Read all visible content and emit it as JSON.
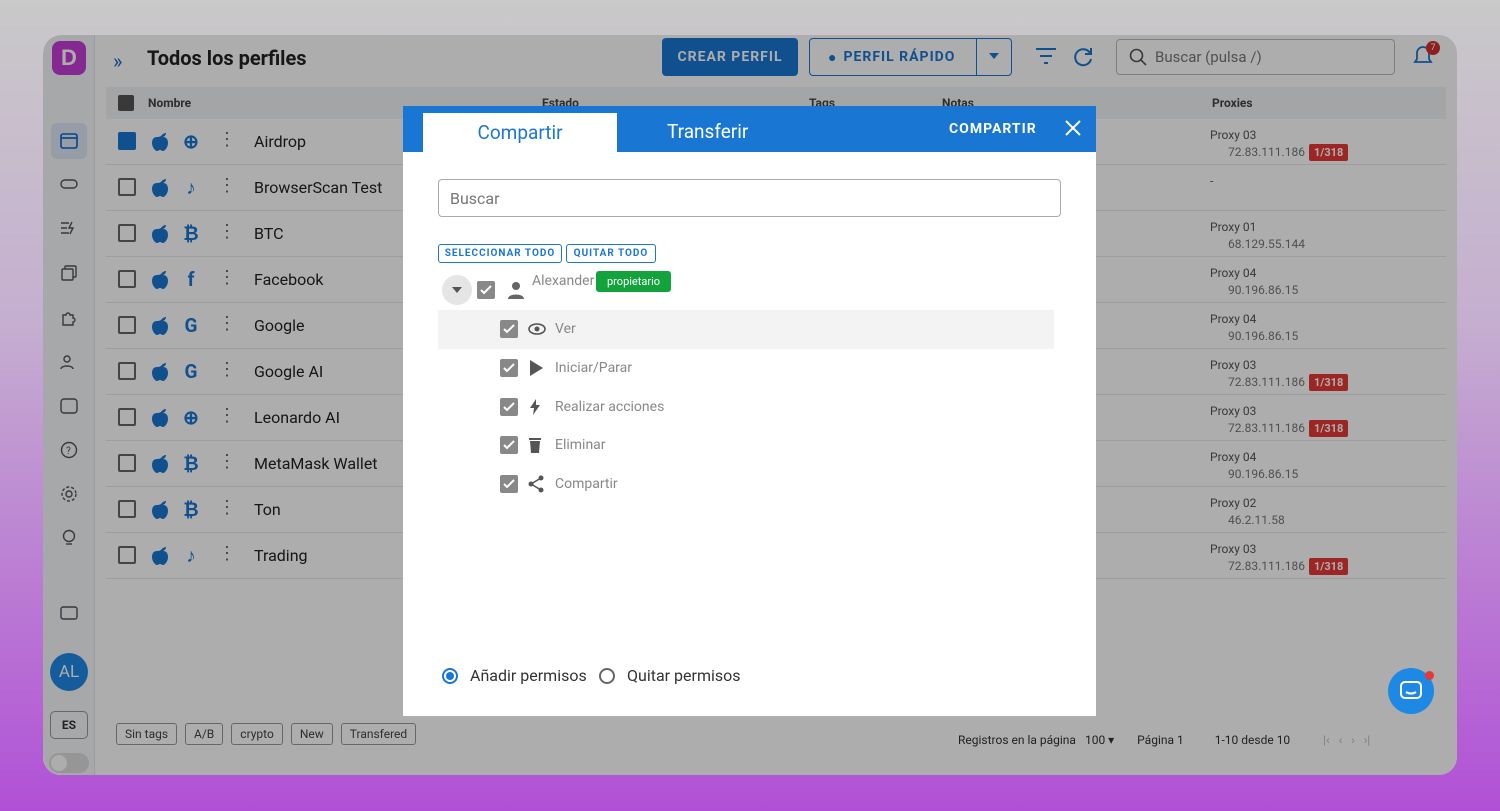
{
  "app": {
    "logo": "D",
    "page_title": "Todos los perfiles",
    "avatar_initials": "AL",
    "language": "ES",
    "create_label": "CREAR PERFIL",
    "quick_label": "PERFIL RÁPIDO",
    "search_placeholder": "Buscar (pulsa /)",
    "notification_count": "7"
  },
  "table": {
    "headers": {
      "name": "Nombre",
      "status": "Estado",
      "tags": "Tags",
      "notes": "Notas",
      "proxies": "Proxies"
    },
    "rows": [
      {
        "name": "Airdrop",
        "checked": true,
        "icon": "globe-icon",
        "proxy": "Proxy 03",
        "ip": "72.83.111.186",
        "limit": "1/318"
      },
      {
        "name": "BrowserScan Test",
        "checked": false,
        "icon": "tiktok-icon",
        "proxy": "-",
        "ip": "",
        "limit": ""
      },
      {
        "name": "BTC",
        "checked": false,
        "icon": "bitcoin-icon",
        "proxy": "Proxy 01",
        "ip": "68.129.55.144",
        "limit": ""
      },
      {
        "name": "Facebook",
        "checked": false,
        "icon": "facebook-icon",
        "proxy": "Proxy 04",
        "ip": "90.196.86.15",
        "limit": ""
      },
      {
        "name": "Google",
        "checked": false,
        "icon": "google-icon",
        "proxy": "Proxy 04",
        "ip": "90.196.86.15",
        "limit": ""
      },
      {
        "name": "Google AI",
        "checked": false,
        "icon": "google-icon",
        "proxy": "Proxy 03",
        "ip": "72.83.111.186",
        "limit": "1/318"
      },
      {
        "name": "Leonardo AI",
        "checked": false,
        "icon": "globe-icon",
        "proxy": "Proxy 03",
        "ip": "72.83.111.186",
        "limit": "1/318"
      },
      {
        "name": "MetaMask Wallet",
        "checked": false,
        "icon": "bitcoin-icon",
        "proxy": "Proxy 04",
        "ip": "90.196.86.15",
        "limit": ""
      },
      {
        "name": "Ton",
        "checked": false,
        "icon": "bitcoin-icon",
        "proxy": "Proxy 02",
        "ip": "46.2.11.58",
        "limit": ""
      },
      {
        "name": "Trading",
        "checked": false,
        "icon": "tiktok-icon",
        "proxy": "Proxy 03",
        "ip": "72.83.111.186",
        "limit": "1/318"
      }
    ]
  },
  "footer": {
    "tags": [
      "Sin tags",
      "A/B",
      "crypto",
      "New",
      "Transfered"
    ],
    "per_page_label": "Registros en la página",
    "per_page": "100",
    "page_label": "Página",
    "page": "1",
    "range": "1-10 desde 10"
  },
  "modal": {
    "tab_share": "Compartir",
    "tab_transfer": "Transferir",
    "action": "COMPARTIR",
    "search_placeholder": "Buscar",
    "select_all": "SELECCIONAR TODO",
    "remove_all": "QUITAR TODO",
    "user": "Alexander",
    "owner_badge": "propietario",
    "permissions": [
      "Ver",
      "Iniciar/Parar",
      "Realizar acciones",
      "Eliminar",
      "Compartir"
    ],
    "radio_add": "Añadir permisos",
    "radio_remove": "Quitar permisos"
  },
  "colors": {
    "accent": "#1976d2",
    "owner": "#12a33c",
    "danger": "#e53935"
  }
}
